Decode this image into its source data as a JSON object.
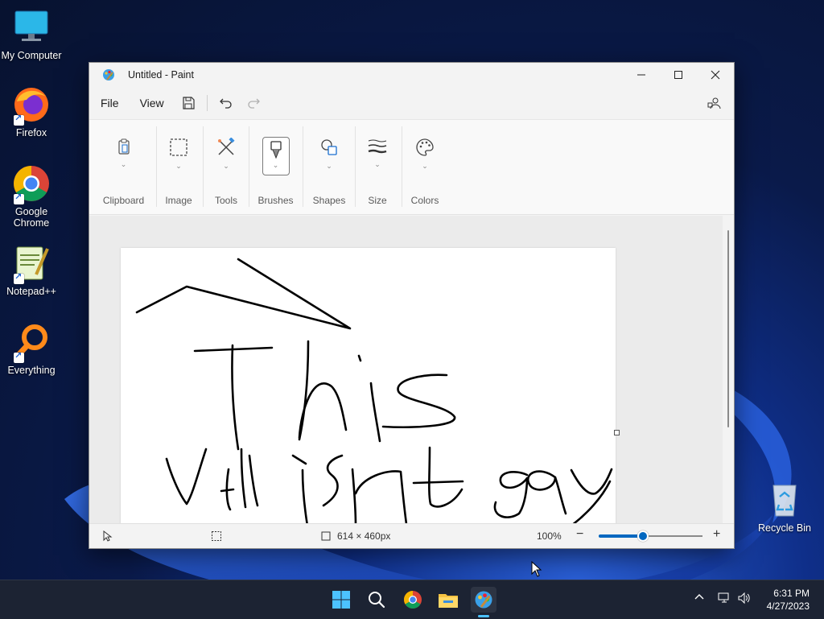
{
  "desktop": {
    "icons": [
      {
        "label": "My Computer"
      },
      {
        "label": "Firefox"
      },
      {
        "label": "Google Chrome"
      },
      {
        "label": "Notepad++"
      },
      {
        "label": "Everything"
      },
      {
        "label": "Recycle Bin"
      }
    ]
  },
  "window": {
    "title": "Untitled - Paint",
    "menu": {
      "file": "File",
      "view": "View"
    },
    "ribbon": {
      "groups": [
        {
          "label": "Clipboard",
          "icon": "clipboard-icon"
        },
        {
          "label": "Image",
          "icon": "selection-icon"
        },
        {
          "label": "Tools",
          "icon": "tools-icon"
        },
        {
          "label": "Brushes",
          "icon": "brush-icon"
        },
        {
          "label": "Shapes",
          "icon": "shapes-icon"
        },
        {
          "label": "Size",
          "icon": "size-icon"
        },
        {
          "label": "Colors",
          "icon": "palette-icon"
        }
      ]
    },
    "status": {
      "canvas_size": "614 × 460px",
      "zoom": "100%",
      "zoom_level": 0.43
    }
  },
  "taskbar": {
    "time": "6:31 PM",
    "date": "4/27/2023"
  },
  "colors": {
    "accent": "#0067c0",
    "taskbar": "#1c2333"
  }
}
